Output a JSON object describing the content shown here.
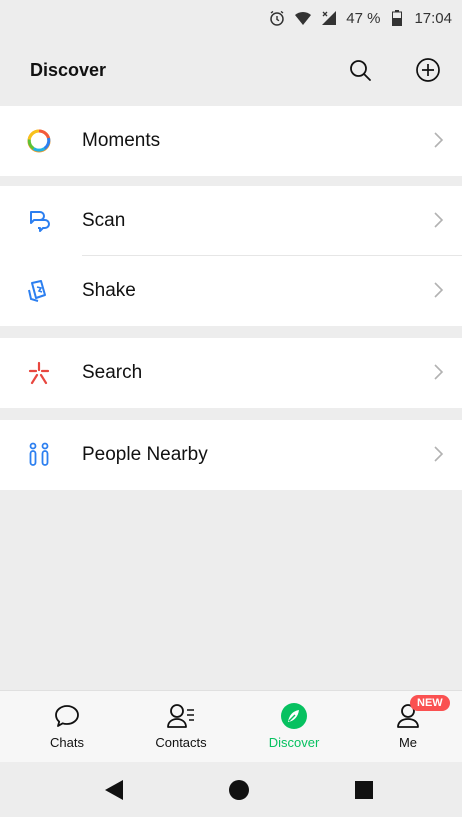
{
  "status_bar": {
    "battery": "47 %",
    "time": "17:04",
    "icons": [
      "alarm-icon",
      "wifi-icon",
      "cell-signal-icon",
      "battery-icon"
    ]
  },
  "header": {
    "title": "Discover",
    "icons": [
      "search-icon",
      "add-circle-icon"
    ]
  },
  "items": {
    "moments": {
      "label": "Moments",
      "icon": "moments-icon"
    },
    "scan": {
      "label": "Scan",
      "icon": "scan-icon"
    },
    "shake": {
      "label": "Shake",
      "icon": "shake-icon"
    },
    "search": {
      "label": "Search",
      "icon": "search-sparkle-icon"
    },
    "people_nearby": {
      "label": "People Nearby",
      "icon": "people-nearby-icon"
    }
  },
  "tabs": {
    "chats": {
      "label": "Chats",
      "icon": "chat-bubble-icon"
    },
    "contacts": {
      "label": "Contacts",
      "icon": "contacts-icon"
    },
    "discover": {
      "label": "Discover",
      "icon": "compass-icon",
      "active": true
    },
    "me": {
      "label": "Me",
      "icon": "person-icon",
      "badge": "NEW"
    }
  },
  "nav": {
    "icons": [
      "back-icon",
      "home-icon",
      "recents-icon"
    ]
  },
  "colors": {
    "accent": "#07c160",
    "badge": "#fa5151",
    "background": "#ededed"
  }
}
